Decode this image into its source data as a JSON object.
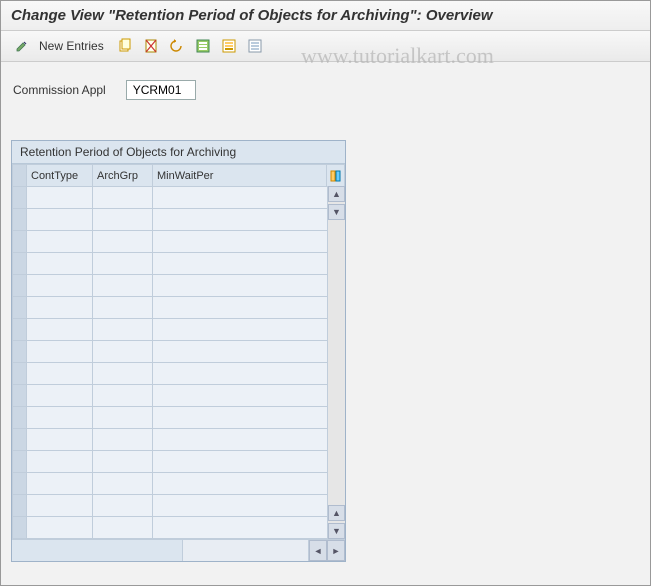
{
  "header": {
    "title": "Change View \"Retention Period of Objects for Archiving\": Overview"
  },
  "toolbar": {
    "new_entries_label": "New Entries"
  },
  "watermark": "www.tutorialkart.com",
  "form": {
    "commission_appl_label": "Commission Appl",
    "commission_appl_value": "YCRM01"
  },
  "table": {
    "title": "Retention Period of Objects for Archiving",
    "columns": {
      "cont_type": "ContType",
      "arch_grp": "ArchGrp",
      "min_wait_per": "MinWaitPer"
    },
    "row_count": 16
  }
}
